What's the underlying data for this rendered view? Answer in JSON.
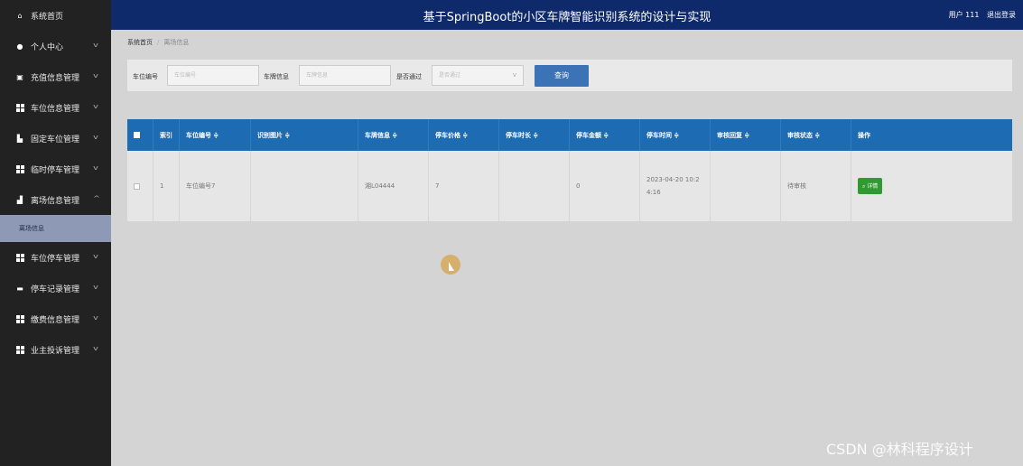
{
  "header": {
    "title": "基于SpringBoot的小区车牌智能识别系统的设计与实现",
    "user": "用户 111",
    "logout": "退出登录"
  },
  "sidebar": {
    "items": [
      {
        "label": "系统首页"
      },
      {
        "label": "个人中心"
      },
      {
        "label": "充值信息管理"
      },
      {
        "label": "车位信息管理"
      },
      {
        "label": "固定车位管理"
      },
      {
        "label": "临时停车管理"
      },
      {
        "label": "离场信息管理"
      },
      {
        "label": "车位停车管理"
      },
      {
        "label": "停车记录管理"
      },
      {
        "label": "缴费信息管理"
      },
      {
        "label": "业主投诉管理"
      }
    ],
    "sub_active": "离场信息"
  },
  "breadcrumb": {
    "home": "系统首页",
    "current": "离场信息"
  },
  "search": {
    "field1_label": "车位编号",
    "field1_placeholder": "车位编号",
    "field2_label": "车牌信息",
    "field2_placeholder": "车牌信息",
    "field3_label": "是否通过",
    "field3_placeholder": "是否通过",
    "button": "查询"
  },
  "table": {
    "headers": [
      "索引",
      "车位编号 ≑",
      "识别图片 ≑",
      "车牌信息 ≑",
      "停车价格 ≑",
      "停车时长 ≑",
      "停车金额 ≑",
      "停车时间 ≑",
      "审核回复 ≑",
      "审核状态 ≑",
      "操作"
    ],
    "row": {
      "index": "1",
      "spot": "车位编号7",
      "image": "",
      "plate": "湘L04444",
      "price": "7",
      "duration": "",
      "amount": "0",
      "time": "2023-04-20 10:2 4:16",
      "reply": "",
      "status": "待审核",
      "action": "详情"
    }
  },
  "watermark": "CSDN @林科程序设计"
}
